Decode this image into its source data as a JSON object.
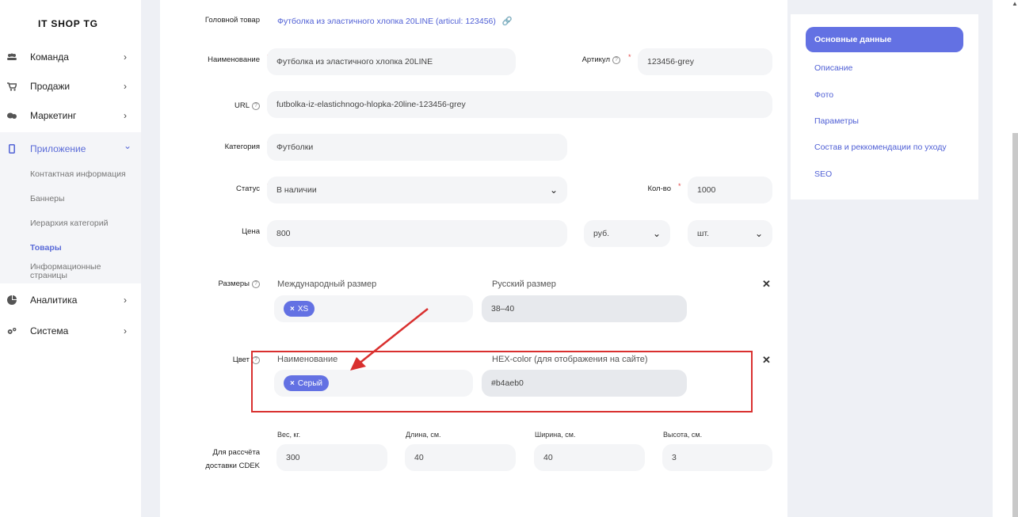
{
  "sidebar": {
    "brand": "IT SHOP TG",
    "items": [
      {
        "label": "Команда",
        "icon": "team-icon"
      },
      {
        "label": "Продажи",
        "icon": "cart-icon"
      },
      {
        "label": "Маркетинг",
        "icon": "marketing-icon"
      },
      {
        "label": "Приложение",
        "icon": "mobile-icon"
      },
      {
        "label": "Аналитика",
        "icon": "analytics-icon"
      },
      {
        "label": "Система",
        "icon": "gears-icon"
      }
    ],
    "sub_items": [
      "Контактная информация",
      "Баннеры",
      "Иерархия категорий",
      "Товары",
      "Информационные страницы"
    ],
    "chevron_right": "›",
    "chevron_down": "⌄"
  },
  "form": {
    "parent_label": "Головной товар",
    "parent_value": "Футболка из эластичного хлопка 20LINE (articul: 123456)",
    "parent_link_icon": "🔗",
    "name_label": "Наименование",
    "name_value": "Футболка из эластичного хлопка 20LINE",
    "article_label": "Артикул",
    "article_value": "123456-grey",
    "url_label": "URL",
    "url_value": "futbolka-iz-elastichnogo-hlopka-20line-123456-grey",
    "category_label": "Категория",
    "category_value": "Футболки",
    "status_label": "Статус",
    "status_value": "В наличии",
    "qty_label": "Кол-во",
    "qty_value": "1000",
    "price_label": "Цена",
    "price_value": "800",
    "currency_value": "руб.",
    "unit_value": "шт.",
    "sizes_label": "Размеры",
    "intl_size_label": "Международный размер",
    "intl_size_tag": "XS",
    "ru_size_label": "Русский размер",
    "ru_size_value": "38–40",
    "color_label": "Цвет",
    "color_name_label": "Наименование",
    "color_tag": "Серый",
    "hex_label": "HEX-color (для отображения на сайте)",
    "hex_value": "#b4aeb0",
    "cdek_label_1": "Для рассчёта",
    "cdek_label_2": "доставки CDEK",
    "weight_label": "Вес, кг.",
    "weight_value": "300",
    "length_label": "Длина, см.",
    "length_value": "40",
    "width_label": "Ширина, см.",
    "width_value": "40",
    "height_label": "Высота, см.",
    "height_value": "3",
    "required_mark": "*",
    "help_mark": "?",
    "tag_remove": "×",
    "row_remove": "✕",
    "caret": "⌄"
  },
  "panel": {
    "active": "Основные данные",
    "links": [
      "Описание",
      "Фото",
      "Параметры",
      "Состав и реккомендации по уходу",
      "SEO"
    ]
  },
  "colors": {
    "accent": "#6371e3",
    "highlight": "#d9302f"
  }
}
